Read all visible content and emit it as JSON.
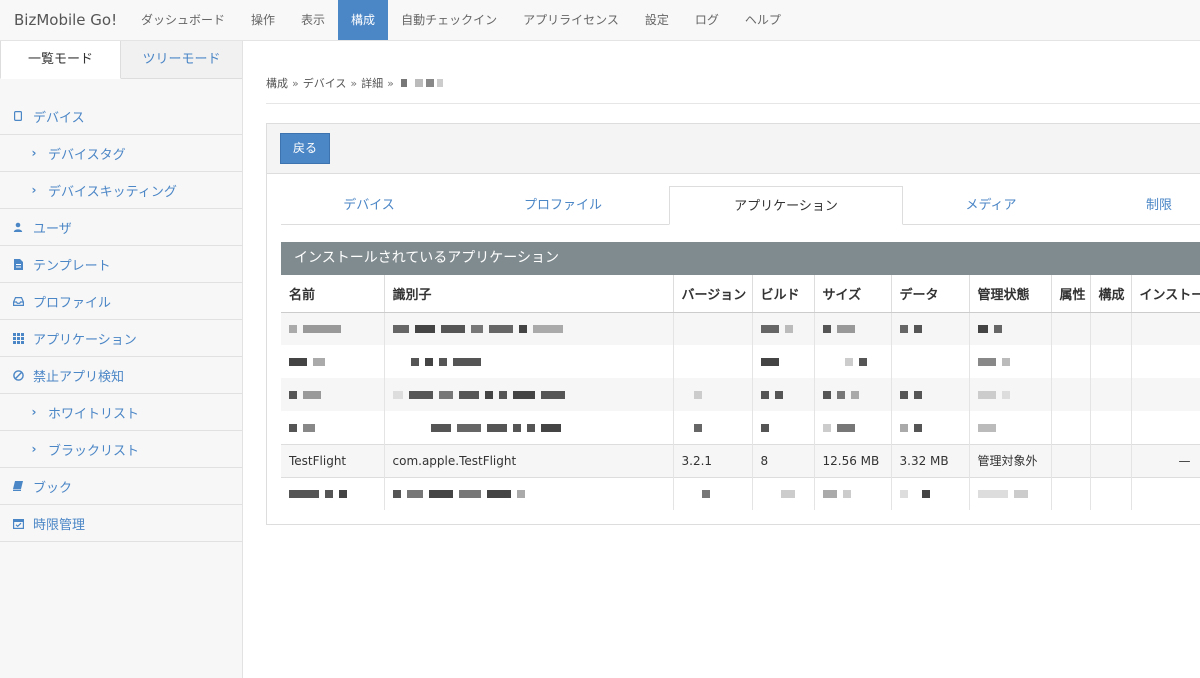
{
  "app": {
    "brand": "BizMobile Go!"
  },
  "nav": {
    "items": [
      {
        "label": "ダッシュボード"
      },
      {
        "label": "操作"
      },
      {
        "label": "表示"
      },
      {
        "label": "構成",
        "active": true
      },
      {
        "label": "自動チェックイン"
      },
      {
        "label": "アプリライセンス"
      },
      {
        "label": "設定"
      },
      {
        "label": "ログ"
      },
      {
        "label": "ヘルプ"
      }
    ]
  },
  "sidebar": {
    "mode_tabs": [
      {
        "label": "一覧モード",
        "active": true
      },
      {
        "label": "ツリーモード"
      }
    ],
    "items": [
      {
        "label": "デバイス",
        "icon": "device-icon"
      },
      {
        "label": "デバイスタグ",
        "icon": "chevron-right-icon",
        "sub": true
      },
      {
        "label": "デバイスキッティング",
        "icon": "chevron-right-icon",
        "sub": true
      },
      {
        "label": "ユーザ",
        "icon": "user-icon"
      },
      {
        "label": "テンプレート",
        "icon": "file-icon"
      },
      {
        "label": "プロファイル",
        "icon": "inbox-icon"
      },
      {
        "label": "アプリケーション",
        "icon": "grid-icon"
      },
      {
        "label": "禁止アプリ検知",
        "icon": "ban-icon"
      },
      {
        "label": "ホワイトリスト",
        "icon": "chevron-right-icon",
        "sub": true
      },
      {
        "label": "ブラックリスト",
        "icon": "chevron-right-icon",
        "sub": true
      },
      {
        "label": "ブック",
        "icon": "book-icon"
      },
      {
        "label": "時限管理",
        "icon": "calendar-icon"
      }
    ]
  },
  "breadcrumb": {
    "items": [
      "構成",
      "デバイス",
      "詳細"
    ],
    "separator": "»"
  },
  "panel": {
    "back_label": "戻る",
    "tabs": [
      {
        "label": "デバイス"
      },
      {
        "label": "プロファイル"
      },
      {
        "label": "アプリケーション",
        "active": true
      },
      {
        "label": "メディア"
      },
      {
        "label": "制限"
      }
    ]
  },
  "apps": {
    "title": "インストールされているアプリケーション",
    "columns": [
      "名前",
      "識別子",
      "バージョン",
      "ビルド",
      "サイズ",
      "データ",
      "管理状態",
      "属性",
      "構成",
      "インストー"
    ],
    "visible_row": {
      "name": "TestFlight",
      "identifier": "com.apple.TestFlight",
      "version": "3.2.1",
      "build": "8",
      "size": "12.56 MB",
      "data": "3.32 MB",
      "status": "管理対象外",
      "attribute": "",
      "config": "",
      "install": "—"
    }
  },
  "colors": {
    "accent": "#4b86c6",
    "section_header": "#808b8f"
  }
}
